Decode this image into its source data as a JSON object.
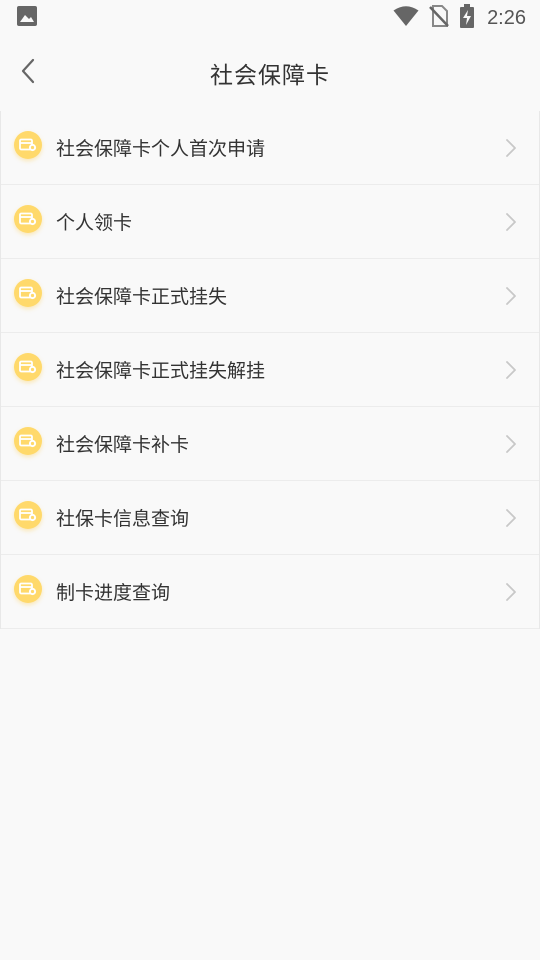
{
  "status_bar": {
    "time": "2:26",
    "icons": [
      "image-icon",
      "wifi-icon",
      "no-sim-icon",
      "battery-charging-icon"
    ]
  },
  "nav": {
    "title": "社会保障卡",
    "back_icon": "chevron-left-icon"
  },
  "colors": {
    "icon_bg": "#ffd96b",
    "background": "#f9f9f9",
    "text": "#333333",
    "chevron": "#c8c8c8"
  },
  "menu": {
    "items": [
      {
        "label": "社会保障卡个人首次申请",
        "icon": "card-icon"
      },
      {
        "label": "个人领卡",
        "icon": "card-icon"
      },
      {
        "label": "社会保障卡正式挂失",
        "icon": "card-icon"
      },
      {
        "label": "社会保障卡正式挂失解挂",
        "icon": "card-icon"
      },
      {
        "label": "社会保障卡补卡",
        "icon": "card-icon"
      },
      {
        "label": "社保卡信息查询",
        "icon": "card-icon"
      },
      {
        "label": "制卡进度查询",
        "icon": "card-icon"
      }
    ]
  }
}
